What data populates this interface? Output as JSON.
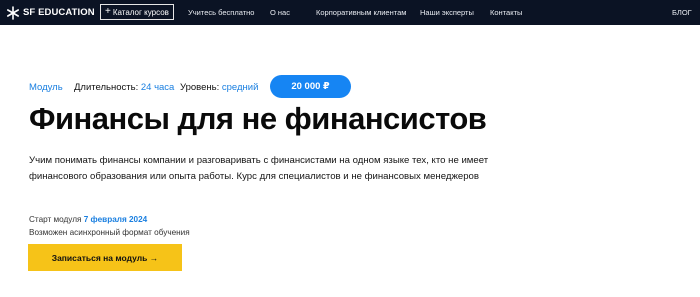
{
  "nav": {
    "logo_text": "SF EDUCATION",
    "catalog_label": "Каталог курсов",
    "links": [
      "Учитесь бесплатно",
      "О нас",
      "Корпоративным клиентам",
      "Наши эксперты",
      "Контакты"
    ],
    "blog": "БЛОГ"
  },
  "course": {
    "type": "Модуль",
    "duration_label": "Длительность:",
    "duration_value": "24 часа",
    "level_label": "Уровень:",
    "level_value": "средний",
    "price": "20 000 ₽",
    "title": "Финансы для не финансистов",
    "description": "Учим понимать финансы компании и разговаривать с финансистами на одном языке тех, кто не имеет финансового образования или опыта работы. Курс для специалистов и не финансовых менеджеров",
    "start_label": "Старт модуля",
    "start_date": "7 февраля 2024",
    "format_note": "Возможен асинхронный формат обучения",
    "enroll_label": "Записаться на модуль →"
  },
  "colors": {
    "nav_bg": "#0b1324",
    "accent_blue": "#1685f3",
    "cta_yellow": "#f6c318"
  },
  "icons": {
    "logo": "sf-snowflake-icon",
    "catalog": "plus-icon"
  }
}
